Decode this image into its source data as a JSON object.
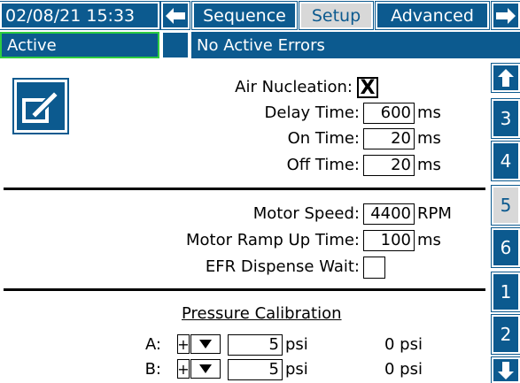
{
  "header": {
    "datetime": "02/08/21 15:33",
    "tabs": [
      {
        "label": "Sequence"
      },
      {
        "label": "Setup"
      },
      {
        "label": "Advanced"
      }
    ]
  },
  "status": {
    "state": "Active",
    "errors": "No Active Errors"
  },
  "nucleation": {
    "air_label": "Air Nucleation:",
    "air_checked": "X",
    "delay_label": "Delay Time:",
    "delay_value": "600",
    "delay_unit": "ms",
    "on_label": "On Time:",
    "on_value": "20",
    "on_unit": "ms",
    "off_label": "Off Time:",
    "off_value": "20",
    "off_unit": "ms"
  },
  "motor": {
    "speed_label": "Motor Speed:",
    "speed_value": "4400",
    "speed_unit": "RPM",
    "ramp_label": "Motor Ramp Up Time:",
    "ramp_value": "100",
    "ramp_unit": "ms",
    "efr_label": "EFR Dispense Wait:"
  },
  "pressure": {
    "title": "Pressure Calibration",
    "rows": [
      {
        "label": "A:",
        "sign": "+",
        "value": "5",
        "unit": "psi",
        "reading": "0 psi"
      },
      {
        "label": "B:",
        "sign": "+",
        "value": "5",
        "unit": "psi",
        "reading": "0 psi"
      }
    ]
  },
  "sidebar": {
    "pages": [
      {
        "label": "3"
      },
      {
        "label": "4"
      },
      {
        "label": "5"
      },
      {
        "label": "6"
      },
      {
        "label": "1"
      },
      {
        "label": "2"
      }
    ]
  },
  "colors": {
    "primary": "#0c5a8f",
    "active_tab": "#d8d8d8",
    "status_active_border": "#2ecc40"
  }
}
